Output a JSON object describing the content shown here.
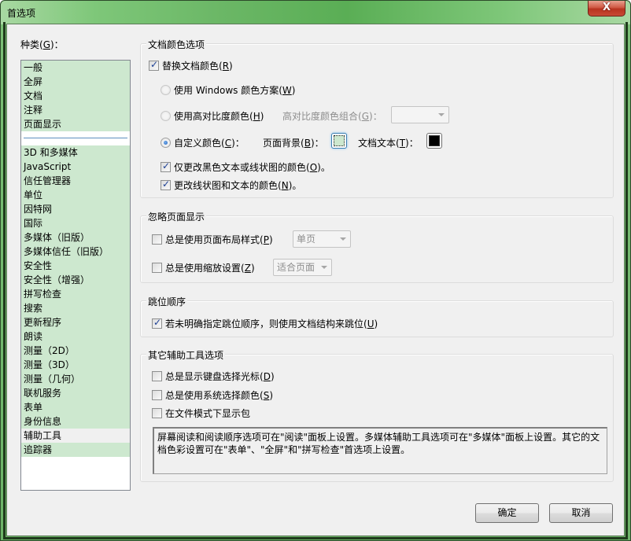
{
  "window": {
    "title": "首选项",
    "close_label": "X"
  },
  "categories": {
    "label_prefix": "种类(",
    "label_key": "G",
    "label_suffix": ")：",
    "items_top": [
      "一般",
      "全屏",
      "文档",
      "注释",
      "页面显示"
    ],
    "items_bottom": [
      "3D 和多媒体",
      "JavaScript",
      "信任管理器",
      "单位",
      "因特网",
      "国际",
      "多媒体（旧版）",
      "多媒体信任（旧版）",
      "安全性",
      "安全性（增强）",
      "拼写检查",
      "搜索",
      "更新程序",
      "朗读",
      "测量（2D）",
      "测量（3D）",
      "测量（几何）",
      "联机服务",
      "表单",
      "身份信息",
      "辅助工具",
      "追踪器"
    ],
    "selected": "辅助工具"
  },
  "doc_colors": {
    "title": "文档颜色选项",
    "replace": {
      "label": "替换文档颜色",
      "key": "R",
      "checked": true
    },
    "use_windows": {
      "label": "使用 Windows 颜色方案",
      "key": "W",
      "selected": false
    },
    "use_high_contrast": {
      "label": "使用高对比度颜色",
      "key": "H",
      "selected": false
    },
    "high_contrast_combo_label": "高对比度颜色组合",
    "high_contrast_combo_key": "G",
    "high_contrast_combo_value": "",
    "custom": {
      "label": "自定义颜色",
      "key": "C",
      "selected": true
    },
    "page_bg_label": "页面背景",
    "page_bg_key": "B",
    "page_bg_color": "#cde8cf",
    "doc_text_label": "文档文本",
    "doc_text_key": "T",
    "doc_text_color": "#000000",
    "only_black": {
      "label": "仅更改黑色文本或线状图的颜色",
      "key": "O",
      "checked": true
    },
    "change_line_art": {
      "label": "更改线状图和文本的颜色",
      "key": "N",
      "checked": true
    }
  },
  "override_page_display": {
    "title": "忽略页面显示",
    "layout": {
      "label": "总是使用页面布局样式",
      "key": "P",
      "checked": false,
      "combo_value": "单页"
    },
    "zoom": {
      "label": "总是使用缩放设置",
      "key": "Z",
      "checked": false,
      "combo_value": "适合页面"
    }
  },
  "tab_order": {
    "title": "跳位顺序",
    "use_structure": {
      "label": "若未明确指定跳位顺序，则使用文档结构来跳位",
      "key": "U",
      "checked": true
    }
  },
  "other_options": {
    "title": "其它辅助工具选项",
    "keyboard_cursor": {
      "label": "总是显示键盘选择光标",
      "key": "D",
      "checked": false
    },
    "system_colors": {
      "label": "总是使用系统选择颜色",
      "key": "S",
      "checked": false
    },
    "show_portfolio": {
      "label": "在文件模式下显示包",
      "checked": false
    },
    "info_text": "屏幕阅读和阅读顺序选项可在\"阅读\"面板上设置。多媒体辅助工具选项可在\"多媒体\"面板上设置。其它的文档色彩设置可在\"表单\"、\"全屏\"和\"拼写检查\"首选项上设置。"
  },
  "buttons": {
    "ok": "确定",
    "cancel": "取消"
  }
}
